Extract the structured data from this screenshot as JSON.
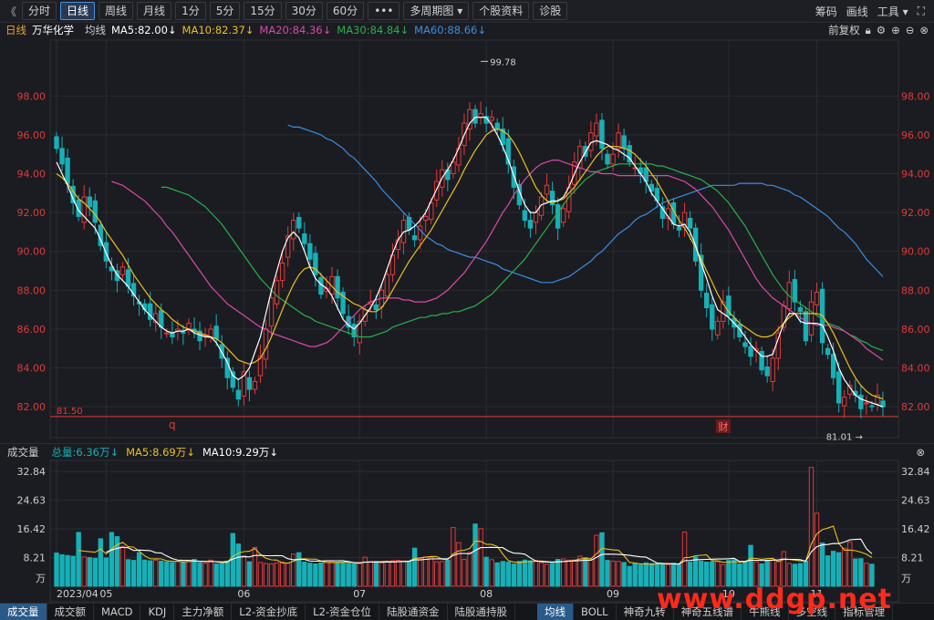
{
  "toolbar": {
    "back_label": "《",
    "periods": [
      {
        "label": "分时",
        "active": false
      },
      {
        "label": "日线",
        "active": true
      },
      {
        "label": "周线",
        "active": false
      },
      {
        "label": "月线",
        "active": false
      },
      {
        "label": "1分",
        "active": false
      },
      {
        "label": "5分",
        "active": false
      },
      {
        "label": "15分",
        "active": false
      },
      {
        "label": "30分",
        "active": false
      },
      {
        "label": "60分",
        "active": false
      },
      {
        "label": "•••",
        "active": false
      },
      {
        "label": "多周期图 ▾",
        "active": false
      },
      {
        "label": "个股资料",
        "active": false
      },
      {
        "label": "诊股",
        "active": false
      }
    ],
    "right": {
      "chips": "筹码",
      "draw": "画线",
      "tools": "工具 ▾",
      "expand": "⛶"
    }
  },
  "indicator": {
    "period": "日线",
    "stock": "万华化学",
    "avg_label": "均线",
    "ma5": "MA5:82.00↓",
    "ma10": "MA10:82.37↓",
    "ma20": "MA20:84.36↓",
    "ma30": "MA30:84.84↓",
    "ma60": "MA60:88.66↓",
    "adjust": "前复权"
  },
  "volume": {
    "title": "成交量",
    "total": "总量:6.36万↓",
    "ma5": "MA5:8.69万↓",
    "ma10": "MA10:9.29万↓"
  },
  "markers": {
    "q": "q",
    "cai": "财",
    "high": "99.78",
    "low": "81.01",
    "support": "81.50"
  },
  "bottom_tabs": [
    "成交量",
    "成交额",
    "MACD",
    "KDJ",
    "主力净额",
    "L2-资金抄底",
    "L2-资金仓位",
    "陆股通资金",
    "陆股通持股",
    "均线",
    "BOLL",
    "神奇九转",
    "神奇五线谱",
    "牛熊线",
    "多空线",
    "指标管理"
  ],
  "bottom_active": [
    "成交量",
    "均线"
  ],
  "watermark": "www.ddgp.net",
  "colors": {
    "up": "#e03a3a",
    "down": "#17b0b7",
    "ma5": "#ffffff",
    "ma10": "#e8c020",
    "ma20": "#d84aa8",
    "ma30": "#28b04a",
    "ma60": "#3a8de0"
  },
  "chart_data": {
    "type": "candlestick",
    "y_ticks": [
      "98.00",
      "96.00",
      "94.00",
      "92.00",
      "90.00",
      "88.00",
      "86.00",
      "84.00",
      "82.00"
    ],
    "y_range": [
      80.6,
      100.5
    ],
    "vol_ticks": [
      "32.84",
      "24.63",
      "16.42",
      "8.21"
    ],
    "vol_unit": "万",
    "vol_range": [
      0,
      36
    ],
    "x_labels": [
      {
        "label": "2023/04",
        "i": 0
      },
      {
        "label": "05",
        "i": 9
      },
      {
        "label": "06",
        "i": 34
      },
      {
        "label": "07",
        "i": 55
      },
      {
        "label": "08",
        "i": 78
      },
      {
        "label": "09",
        "i": 101
      },
      {
        "label": "10",
        "i": 122
      },
      {
        "label": "11",
        "i": 138
      }
    ],
    "closes": [
      95.3,
      94.5,
      93.5,
      92.5,
      91.8,
      92.8,
      92.3,
      91.5,
      90.3,
      89.5,
      89.0,
      88.5,
      89.2,
      88.2,
      87.7,
      87.3,
      87.0,
      86.5,
      86.8,
      86.1,
      85.8,
      85.6,
      86.0,
      85.8,
      86.3,
      85.9,
      85.4,
      85.7,
      86.0,
      85.5,
      84.5,
      83.5,
      83.0,
      82.4,
      83.8,
      82.9,
      83.3,
      84.6,
      86.0,
      87.6,
      88.5,
      89.4,
      90.8,
      91.6,
      91.2,
      90.4,
      89.6,
      88.8,
      87.8,
      88.1,
      88.7,
      87.6,
      86.8,
      86.1,
      85.6,
      86.4,
      87.0,
      87.4,
      87.0,
      88.0,
      88.8,
      89.8,
      90.6,
      91.6,
      91.1,
      90.6,
      91.3,
      91.8,
      92.5,
      93.6,
      94.2,
      93.7,
      94.6,
      95.3,
      96.6,
      97.3,
      96.6,
      97.1,
      96.6,
      96.9,
      96.3,
      95.5,
      94.5,
      93.3,
      92.4,
      91.6,
      91.2,
      92.0,
      92.8,
      93.4,
      92.4,
      91.2,
      92.2,
      93.3,
      94.6,
      95.4,
      94.9,
      96.1,
      96.6,
      95.3,
      94.5,
      95.0,
      96.1,
      95.3,
      94.6,
      94.3,
      94.0,
      93.6,
      93.1,
      92.6,
      91.7,
      92.2,
      91.4,
      91.1,
      92.0,
      91.2,
      89.5,
      88.0,
      87.1,
      86.0,
      86.4,
      87.4,
      86.7,
      86.1,
      85.6,
      85.1,
      84.6,
      85.0,
      83.9,
      83.6,
      84.5,
      85.8,
      87.2,
      88.4,
      87.4,
      86.9,
      85.4,
      87.4,
      87.9,
      85.3,
      84.7,
      83.5,
      82.2,
      82.5,
      83.1,
      82.6,
      81.9,
      82.2,
      82.0,
      82.6,
      82.0
    ],
    "ma5": [
      94.6,
      94.0,
      93.4,
      92.7,
      92.1,
      91.8,
      91.5,
      91.2,
      90.6,
      89.9,
      89.3,
      88.8,
      88.5,
      88.2,
      87.8,
      87.4,
      87.0,
      86.7,
      86.4,
      86.1,
      85.9,
      85.8,
      85.9,
      85.9,
      86.0,
      85.8,
      85.7,
      85.6,
      85.6,
      85.3,
      84.8,
      84.3,
      83.6,
      83.4,
      83.6,
      84.0,
      84.8,
      85.6,
      86.8,
      88.0,
      89.0,
      90.0,
      90.7,
      91.0,
      90.7,
      90.0,
      89.2,
      88.6,
      88.3,
      88.1,
      87.7,
      87.1,
      86.5,
      86.2,
      86.0,
      86.3,
      86.7,
      87.1,
      87.6,
      88.3,
      89.1,
      89.9,
      90.6,
      91.0,
      91.1,
      91.3,
      91.6,
      92.0,
      92.6,
      93.2,
      93.8,
      94.2,
      94.7,
      95.3,
      96.0,
      96.6,
      96.9,
      96.9,
      96.9,
      96.5,
      96.0,
      95.4,
      94.7,
      93.9,
      93.1,
      92.4,
      92.0,
      92.0,
      92.4,
      92.5,
      92.6,
      92.6,
      92.8,
      93.3,
      94.0,
      94.6,
      95.1,
      95.6,
      95.7,
      95.6,
      95.5,
      95.3,
      95.2,
      95.0,
      94.8,
      94.4,
      94.0,
      93.6,
      93.0,
      92.6,
      92.2,
      91.8,
      91.4,
      91.3,
      91.4,
      91.0,
      90.3,
      89.4,
      88.6,
      87.7,
      87.0,
      86.8,
      86.6,
      86.3,
      86.0,
      85.6,
      85.2,
      84.9,
      84.6,
      84.6,
      84.7,
      85.5,
      86.3,
      86.8,
      86.8,
      86.4,
      86.3,
      86.3,
      86.3,
      86.2,
      85.6,
      84.9,
      84.0,
      83.4,
      83.0,
      82.6,
      82.4,
      82.3,
      82.2,
      82.1,
      82.0
    ],
    "ma10": [
      94.0,
      93.8,
      93.5,
      93.1,
      92.7,
      92.5,
      92.2,
      91.9,
      91.5,
      91.0,
      90.6,
      90.2,
      89.8,
      89.3,
      88.8,
      88.4,
      88.0,
      87.6,
      87.3,
      87.0,
      86.8,
      86.5,
      86.3,
      86.1,
      86.0,
      85.9,
      85.8,
      85.7,
      85.6,
      85.5,
      85.3,
      85.0,
      84.7,
      84.4,
      84.3,
      84.2,
      84.3,
      84.5,
      85.0,
      85.6,
      86.3,
      87.0,
      87.7,
      88.3,
      88.8,
      89.1,
      89.2,
      89.1,
      88.8,
      88.5,
      88.2,
      87.9,
      87.7,
      87.5,
      87.3,
      87.2,
      87.0,
      86.9,
      86.9,
      87.1,
      87.5,
      88.0,
      88.5,
      89.0,
      89.5,
      89.9,
      90.3,
      90.7,
      91.1,
      91.6,
      92.1,
      92.6,
      93.1,
      93.6,
      94.2,
      94.7,
      95.2,
      95.6,
      96.0,
      96.2,
      96.3,
      96.2,
      96.0,
      95.6,
      95.1,
      94.5,
      93.9,
      93.3,
      92.9,
      92.6,
      92.5,
      92.6,
      92.7,
      93.0,
      93.3,
      93.7,
      94.1,
      94.5,
      94.9,
      95.2,
      95.4,
      95.4,
      95.4,
      95.3,
      95.2,
      95.0,
      94.7,
      94.4,
      94.0,
      93.6,
      93.1,
      92.6,
      92.1,
      91.6,
      91.2,
      90.7,
      90.2,
      89.6,
      89.0,
      88.4,
      87.8,
      87.3,
      86.9,
      86.6,
      86.3,
      86.1,
      85.9,
      85.7,
      85.6,
      85.6,
      85.7,
      86.0,
      86.3,
      86.6,
      86.8,
      86.8,
      86.8,
      86.8,
      86.8,
      86.7,
      86.3,
      85.8,
      85.2,
      84.6,
      84.0,
      83.5,
      83.1,
      82.8,
      82.6,
      82.5,
      82.4
    ],
    "ma20": [
      93.6,
      93.5,
      93.4,
      93.2,
      93.0,
      92.8,
      92.6,
      92.3,
      92.0,
      91.7,
      91.3,
      91.0,
      90.6,
      90.2,
      89.8,
      89.4,
      89.0,
      88.6,
      88.2,
      87.9,
      87.6,
      87.3,
      87.1,
      86.9,
      86.7,
      86.5,
      86.3,
      86.1,
      86.0,
      85.8,
      85.7,
      85.6,
      85.5,
      85.4,
      85.3,
      85.2,
      85.1,
      85.1,
      85.2,
      85.3,
      85.5,
      85.8,
      86.1,
      86.4,
      86.7,
      87.0,
      87.2,
      87.4,
      87.5,
      87.6,
      87.6,
      87.6,
      87.6,
      87.5,
      87.5,
      87.4,
      87.4,
      87.4,
      87.5,
      87.6,
      87.8,
      88.0,
      88.3,
      88.6,
      88.9,
      89.3,
      89.7,
      90.1,
      90.5,
      91.0,
      91.5,
      92.0,
      92.4,
      92.9,
      93.3,
      93.7,
      94.0,
      94.3,
      94.5,
      94.6,
      94.7,
      94.7,
      94.6,
      94.5,
      94.4,
      94.3,
      94.2,
      94.1,
      94.1,
      94.0,
      94.0,
      94.0,
      93.9,
      93.9,
      93.9,
      93.9,
      93.9,
      93.9,
      93.9,
      93.9,
      93.9,
      93.9,
      93.8,
      93.7,
      93.6,
      93.4,
      93.2,
      92.9,
      92.6,
      92.3,
      91.9,
      91.5,
      91.1,
      90.6,
      90.1,
      89.6,
      89.1,
      88.6,
      88.2,
      87.9,
      87.6,
      87.4,
      87.2,
      87.0,
      86.8,
      86.6,
      86.4,
      86.3,
      86.2,
      86.2,
      86.2,
      86.1,
      86.0,
      85.9,
      85.7,
      85.5,
      85.3,
      85.0,
      84.8,
      84.6,
      84.4
    ],
    "ma30": [
      93.3,
      93.3,
      93.2,
      93.1,
      93.0,
      92.9,
      92.7,
      92.5,
      92.3,
      92.0,
      91.7,
      91.4,
      91.0,
      90.6,
      90.2,
      89.8,
      89.4,
      89.0,
      88.6,
      88.3,
      88.0,
      87.7,
      87.5,
      87.3,
      87.1,
      86.9,
      86.7,
      86.6,
      86.4,
      86.3,
      86.2,
      86.1,
      86.0,
      85.9,
      85.8,
      85.7,
      85.6,
      85.6,
      85.6,
      85.7,
      85.8,
      85.9,
      86.1,
      86.2,
      86.3,
      86.4,
      86.5,
      86.6,
      86.6,
      86.7,
      86.7,
      86.8,
      86.8,
      86.9,
      86.9,
      87.0,
      87.1,
      87.2,
      87.4,
      87.6,
      87.8,
      88.1,
      88.4,
      88.7,
      89.0,
      89.3,
      89.6,
      90.0,
      90.4,
      90.8,
      91.2,
      91.6,
      92.0,
      92.4,
      92.8,
      93.1,
      93.4,
      93.7,
      93.9,
      94.1,
      94.2,
      94.3,
      94.4,
      94.5,
      94.5,
      94.5,
      94.5,
      94.5,
      94.5,
      94.5,
      94.4,
      94.4,
      94.3,
      94.2,
      94.1,
      94.0,
      93.9,
      93.8,
      93.7,
      93.5,
      93.3,
      93.1,
      92.8,
      92.5,
      92.1,
      91.7,
      91.3,
      90.8,
      90.3,
      89.8,
      89.3,
      88.8,
      88.4,
      88.0,
      87.7,
      87.5,
      87.3,
      87.1,
      86.9,
      86.7,
      86.5,
      86.3,
      86.2,
      86.1,
      85.9,
      85.7,
      85.6,
      85.4,
      85.3,
      85.1,
      85.0,
      84.9
    ],
    "ma60": [
      96.5,
      96.4,
      96.4,
      96.3,
      96.2,
      96.1,
      96.0,
      95.8,
      95.7,
      95.5,
      95.3,
      95.0,
      94.8,
      94.5,
      94.2,
      93.9,
      93.6,
      93.2,
      92.9,
      92.6,
      92.3,
      92.0,
      91.7,
      91.4,
      91.1,
      90.8,
      90.6,
      90.4,
      90.3,
      90.1,
      90.0,
      89.9,
      89.8,
      89.7,
      89.7,
      89.6,
      89.5,
      89.4,
      89.3,
      89.1,
      89.0,
      88.9,
      88.8,
      88.7,
      88.6,
      88.5,
      88.4,
      88.4,
      88.4,
      88.5,
      88.6,
      88.7,
      88.9,
      89.1,
      89.3,
      89.5,
      89.8,
      90.0,
      90.3,
      90.6,
      90.9,
      91.1,
      91.3,
      91.6,
      91.8,
      91.9,
      92.1,
      92.3,
      92.5,
      92.6,
      92.7,
      92.8,
      92.9,
      93.0,
      93.1,
      93.2,
      93.3,
      93.4,
      93.4,
      93.4,
      93.4,
      93.4,
      93.5,
      93.5,
      93.5,
      93.5,
      93.5,
      93.4,
      93.4,
      93.3,
      93.2,
      93.1,
      92.9,
      92.8,
      92.6,
      92.4,
      92.2,
      92.0,
      91.8,
      91.5,
      91.2,
      91.0,
      90.7,
      90.4,
      90.0,
      89.6,
      89.3,
      89.0,
      88.7
    ],
    "volumes": [
      9.5,
      9.0,
      8.8,
      8.6,
      15.4,
      8.4,
      8.2,
      8.0,
      13.6,
      8.1,
      15.4,
      14.2,
      11.4,
      7.6,
      7.4,
      9.6,
      7.5,
      7.3,
      7.5,
      7.2,
      7.0,
      6.8,
      7.1,
      7.0,
      7.3,
      7.7,
      6.8,
      6.6,
      7.5,
      6.4,
      6.5,
      7.2,
      15.1,
      12.1,
      8.7,
      7.0,
      11.1,
      6.8,
      6.5,
      6.4,
      6.7,
      6.9,
      6.6,
      9.2,
      9.6,
      6.9,
      6.6,
      6.4,
      6.7,
      7.2,
      7.0,
      6.9,
      6.8,
      6.6,
      6.4,
      6.5,
      8.3,
      7.0,
      6.9,
      6.7,
      7.0,
      7.3,
      7.4,
      7.2,
      7.1,
      10.9,
      8.0,
      8.4,
      8.2,
      7.0,
      7.1,
      7.4,
      16.8,
      12.5,
      7.7,
      9.7,
      17.8,
      16.5,
      8.3,
      7.6,
      6.7,
      7.1,
      6.9,
      6.4,
      7.1,
      7.5,
      7.3,
      7.4,
      6.8,
      6.3,
      6.6,
      7.7,
      7.8,
      7.5,
      7.5,
      8.6,
      8.2,
      7.6,
      14.6,
      15.3,
      7.4,
      7.2,
      7.1,
      6.8,
      5.7,
      6.4,
      6.1,
      6.7,
      6.5,
      6.5,
      6.4,
      6.2,
      6.6,
      6.3,
      15.5,
      6.9,
      8.4,
      7.2,
      6.9,
      7.0,
      7.0,
      6.2,
      7.4,
      7.6,
      6.4,
      7.1,
      11.7,
      7.0,
      6.4,
      7.3,
      7.6,
      7.1,
      9.9,
      6.5,
      6.3,
      6.5,
      7.2,
      34.0,
      20.9,
      12.4,
      8.7,
      10.0,
      9.6,
      10.9,
      12.6,
      7.8,
      7.9,
      6.6,
      6.3
    ]
  }
}
